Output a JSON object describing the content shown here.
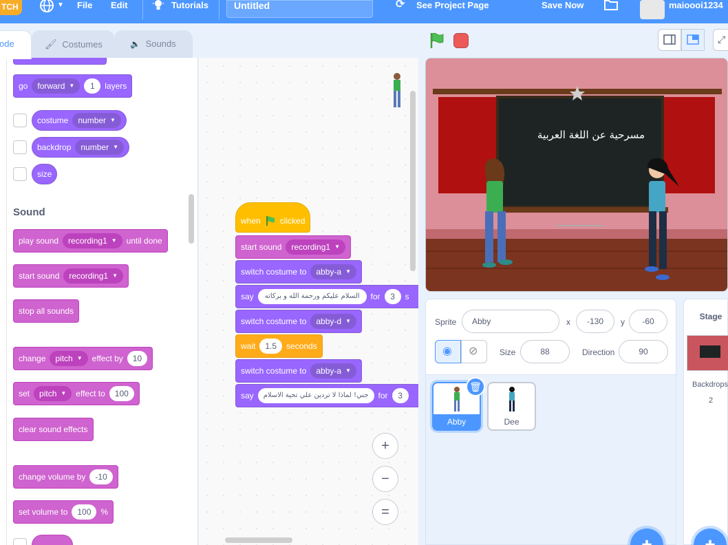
{
  "menubar": {
    "logo": "TCH",
    "file": "File",
    "edit": "Edit",
    "tutorials": "Tutorials",
    "project_title": "Untitled",
    "see_project": "See Project Page",
    "save_now": "Save Now",
    "username": "maioooi1234"
  },
  "tabs": {
    "code": "ode",
    "costumes": "Costumes",
    "sounds": "Sounds"
  },
  "palette": {
    "go_layers": {
      "go": "go",
      "dir": "forward",
      "n": "1",
      "layers": "layers"
    },
    "costume": {
      "label": "costume",
      "opt": "number"
    },
    "backdrop": {
      "label": "backdrop",
      "opt": "number"
    },
    "size": "size",
    "sound_title": "Sound",
    "play_sound": {
      "a": "play sound",
      "opt": "recording1",
      "b": "until done"
    },
    "start_sound": {
      "a": "start sound",
      "opt": "recording1"
    },
    "stop_all": "stop all sounds",
    "change_effect": {
      "a": "change",
      "opt": "pitch",
      "b": "effect by",
      "n": "10"
    },
    "set_effect": {
      "a": "set",
      "opt": "pitch",
      "b": "effect to",
      "n": "100"
    },
    "clear_effects": "clear sound effects",
    "change_volume": {
      "a": "change volume by",
      "n": "-10"
    },
    "set_volume": {
      "a": "set volume to",
      "n": "100",
      "b": "%"
    }
  },
  "script": {
    "hat": {
      "a": "when",
      "b": "clicked"
    },
    "start_sound": {
      "a": "start sound",
      "opt": "recording1"
    },
    "switch1": {
      "a": "switch costume to",
      "opt": "abby-a"
    },
    "say1": {
      "a": "say",
      "text": "السلام عليكم ورحمة الله و بركاته",
      "b": "for",
      "n": "3",
      "c": "s"
    },
    "switch2": {
      "a": "switch costume to",
      "opt": "abby-d"
    },
    "wait": {
      "a": "wait",
      "n": "1.5",
      "b": "seconds"
    },
    "switch3": {
      "a": "switch costume to",
      "opt": "abby-a"
    },
    "say2": {
      "a": "say",
      "text": "جني! لماذا لا تردين علي تحية الاسلام",
      "b": "for",
      "n": "3"
    }
  },
  "zoom": {
    "in": "+",
    "out": "−",
    "reset": "="
  },
  "stage": {
    "board_text": "مسرحية عن اللغة العربية"
  },
  "sprite_info": {
    "sprite_label": "Sprite",
    "sprite_name": "Abby",
    "x_label": "x",
    "x_value": "-130",
    "y_label": "y",
    "y_value": "-60",
    "size_label": "Size",
    "size_value": "88",
    "direction_label": "Direction",
    "direction_value": "90"
  },
  "sprites": [
    {
      "name": "Abby"
    },
    {
      "name": "Dee"
    }
  ],
  "stage_pane": {
    "title": "Stage",
    "backdrops_label": "Backdrops",
    "backdrops_count": "2"
  },
  "colors": {
    "menu": "#4c97ff",
    "looks": "#9966ff",
    "sound": "#cf63cf",
    "events": "#ffbf00",
    "control": "#ffab19"
  }
}
